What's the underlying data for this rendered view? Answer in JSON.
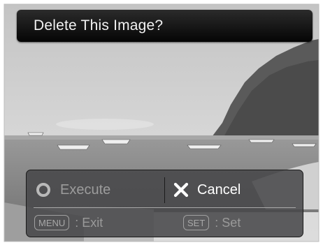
{
  "dialog": {
    "title": "Delete This Image?",
    "options": {
      "execute_label": "Execute",
      "cancel_label": "Cancel"
    },
    "hints": {
      "menu_key": "MENU",
      "menu_action": ": Exit",
      "set_key": "SET",
      "set_action": ": Set"
    }
  },
  "icons": {
    "execute": "circle-icon",
    "cancel": "x-icon"
  },
  "colors": {
    "title_bar": "#0a0a0a",
    "panel": "#464648",
    "selected_text": "#ffffff",
    "dim_text": "#9c9c9c"
  }
}
